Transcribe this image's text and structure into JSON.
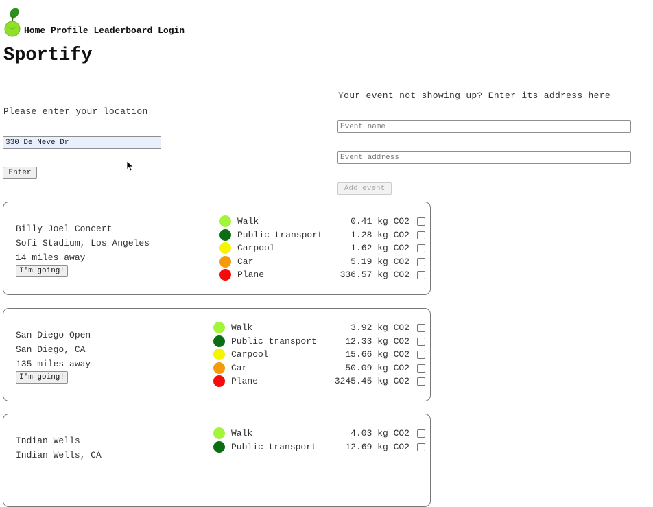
{
  "nav": {
    "items": [
      "Home",
      "Profile",
      "Leaderboard",
      "Login"
    ]
  },
  "app": {
    "title": "Sportify"
  },
  "location": {
    "label": "Please enter your location",
    "value": "330 De Neve Dr",
    "enter_label": "Enter"
  },
  "add_event": {
    "label": "Your event not showing up? Enter its address here",
    "name_placeholder": "Event name",
    "address_placeholder": "Event address",
    "button_label": "Add event"
  },
  "colors": {
    "walk": "#a3f53a",
    "public_transport": "#0b6e12",
    "carpool": "#f5f500",
    "car": "#f59a0b",
    "plane": "#f50b0b"
  },
  "events": [
    {
      "name": "Billy Joel Concert",
      "venue": "Sofi Stadium, Los Angeles",
      "distance": "14 miles away",
      "going_label": "I'm going!",
      "modes": [
        {
          "name": "Walk",
          "co2": "0.41 kg CO2"
        },
        {
          "name": "Public transport",
          "co2": "1.28 kg CO2"
        },
        {
          "name": "Carpool",
          "co2": "1.62 kg CO2"
        },
        {
          "name": "Car",
          "co2": "5.19 kg CO2"
        },
        {
          "name": "Plane",
          "co2": "336.57 kg CO2"
        }
      ]
    },
    {
      "name": "San Diego Open",
      "venue": "San Diego, CA",
      "distance": "135 miles away",
      "going_label": "I'm going!",
      "modes": [
        {
          "name": "Walk",
          "co2": "3.92 kg CO2"
        },
        {
          "name": "Public transport",
          "co2": "12.33 kg CO2"
        },
        {
          "name": "Carpool",
          "co2": "15.66 kg CO2"
        },
        {
          "name": "Car",
          "co2": "50.09 kg CO2"
        },
        {
          "name": "Plane",
          "co2": "3245.45 kg CO2"
        }
      ]
    },
    {
      "name": "Indian Wells",
      "venue": "Indian Wells, CA",
      "distance": "",
      "going_label": "",
      "modes": [
        {
          "name": "Walk",
          "co2": "4.03 kg CO2"
        },
        {
          "name": "Public transport",
          "co2": "12.69 kg CO2"
        }
      ]
    }
  ]
}
